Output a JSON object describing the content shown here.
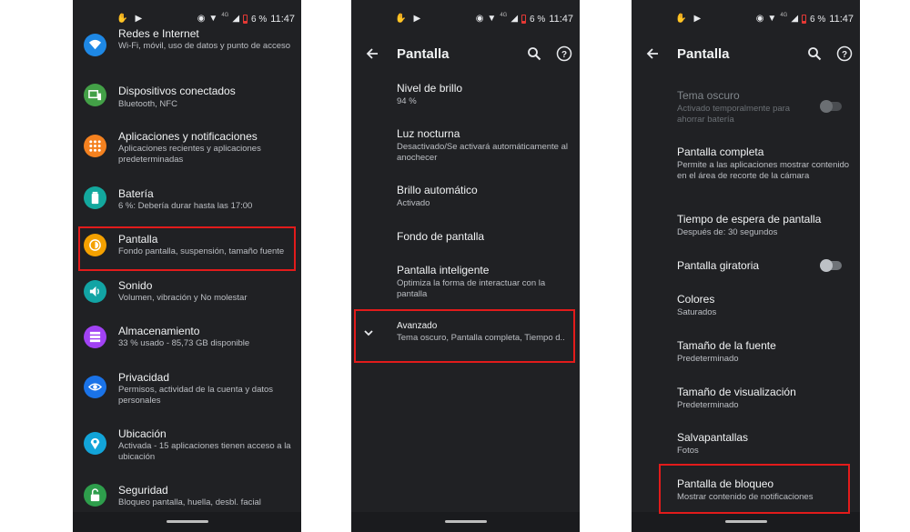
{
  "status": {
    "battery": "6 %",
    "time": "11:47",
    "network": "4G"
  },
  "colors": {
    "highlight": "#e21b1b",
    "background": "#202124"
  },
  "phone1": {
    "items": [
      {
        "title": "Redes e Internet",
        "subtitle": "Wi-Fi, móvil, uso de datos y punto de acceso",
        "icon": "wifi-icon",
        "color": "#1e88e5"
      },
      {
        "title": "Dispositivos conectados",
        "subtitle": "Bluetooth, NFC",
        "icon": "devices-icon",
        "color": "#43a047"
      },
      {
        "title": "Aplicaciones y notificaciones",
        "subtitle": "Aplicaciones recientes y aplicaciones predeterminadas",
        "icon": "apps-icon",
        "color": "#f4811f"
      },
      {
        "title": "Batería",
        "subtitle": "6 %: Debería durar hasta las 17:00",
        "icon": "battery-icon",
        "color": "#13a89e"
      },
      {
        "title": "Pantalla",
        "subtitle": "Fondo pantalla, suspensión, tamaño fuente",
        "icon": "brightness-icon",
        "color": "#f4a100"
      },
      {
        "title": "Sonido",
        "subtitle": "Volumen, vibración y No molestar",
        "icon": "volume-icon",
        "color": "#12a4a4"
      },
      {
        "title": "Almacenamiento",
        "subtitle": "33 % usado - 85,73 GB disponible",
        "icon": "storage-icon",
        "color": "#a142f4"
      },
      {
        "title": "Privacidad",
        "subtitle": "Permisos, actividad de la cuenta y datos personales",
        "icon": "eye-icon",
        "color": "#1a73e8"
      },
      {
        "title": "Ubicación",
        "subtitle": "Activada - 15 aplicaciones tienen acceso a la ubicación",
        "icon": "location-icon",
        "color": "#12a4d9"
      },
      {
        "title": "Seguridad",
        "subtitle": "Bloqueo pantalla, huella, desbl. facial",
        "icon": "lock-icon",
        "color": "#2e9e4c"
      }
    ]
  },
  "phone2": {
    "title": "Pantalla",
    "items": [
      {
        "title": "Nivel de brillo",
        "subtitle": "94 %"
      },
      {
        "title": "Luz nocturna",
        "subtitle": "Desactivado/Se activará automáticamente al anochecer"
      },
      {
        "title": "Brillo automático",
        "subtitle": "Activado"
      },
      {
        "title": "Fondo de pantalla",
        "subtitle": ""
      },
      {
        "title": "Pantalla inteligente",
        "subtitle": "Optimiza la forma de interactuar con la pantalla"
      },
      {
        "title": "Avanzado",
        "subtitle": "Tema oscuro, Pantalla completa, Tiempo d.."
      }
    ]
  },
  "phone3": {
    "title": "Pantalla",
    "items": [
      {
        "title": "Tema oscuro",
        "subtitle": "Activado temporalmente para ahorrar batería"
      },
      {
        "title": "Pantalla completa",
        "subtitle": "Permite a las aplicaciones mostrar contenido en el área de recorte de la cámara"
      },
      {
        "title": "Tiempo de espera de pantalla",
        "subtitle": "Después de: 30 segundos"
      },
      {
        "title": "Pantalla giratoria",
        "subtitle": ""
      },
      {
        "title": "Colores",
        "subtitle": "Saturados"
      },
      {
        "title": "Tamaño de la fuente",
        "subtitle": "Predeterminado"
      },
      {
        "title": "Tamaño de visualización",
        "subtitle": "Predeterminado"
      },
      {
        "title": "Salvapantallas",
        "subtitle": "Fotos"
      },
      {
        "title": "Pantalla de bloqueo",
        "subtitle": "Mostrar contenido de notificaciones"
      }
    ]
  }
}
